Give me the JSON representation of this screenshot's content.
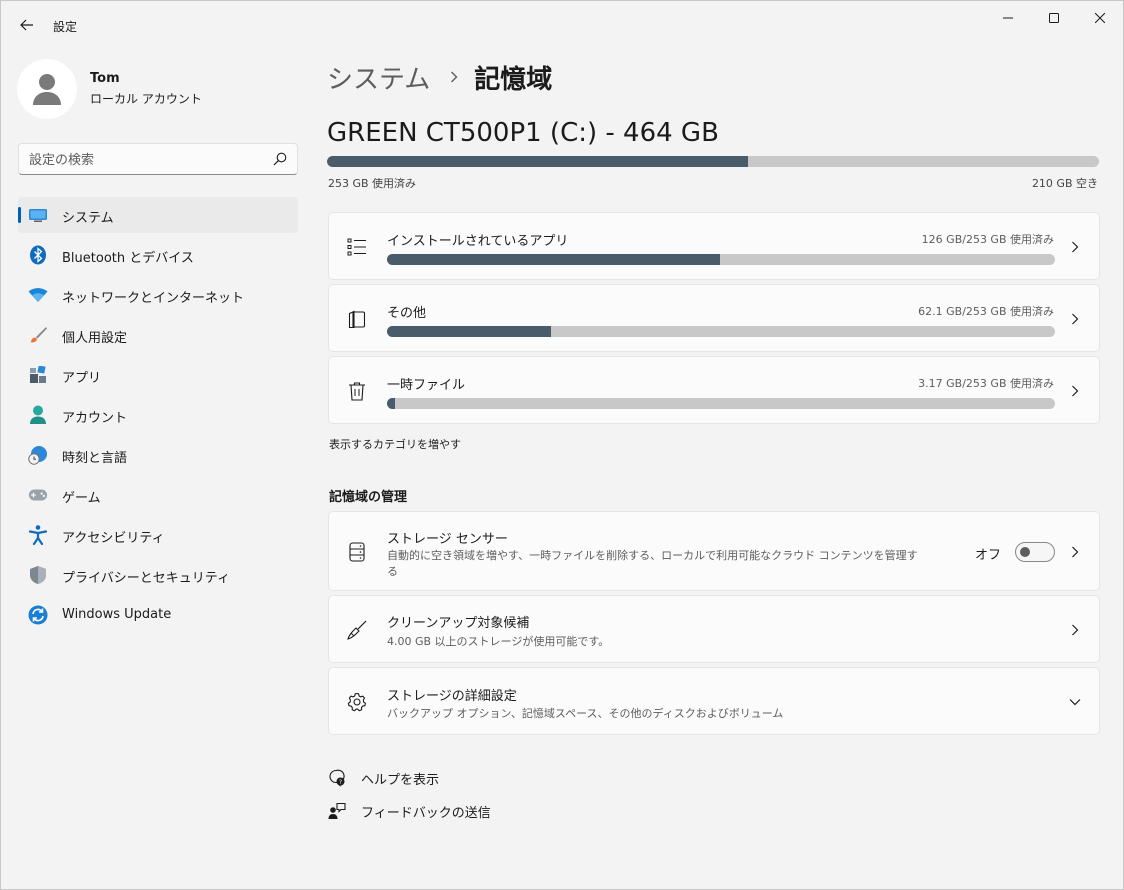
{
  "app": {
    "title": "設定"
  },
  "window_controls": {
    "minimize": "minimize-icon",
    "maximize": "maximize-icon",
    "close": "close-icon"
  },
  "profile": {
    "name": "Tom",
    "account_type": "ローカル アカウント"
  },
  "search": {
    "placeholder": "設定の検索"
  },
  "sidebar": {
    "items": [
      {
        "label": "システム",
        "icon": "system-icon",
        "active": true
      },
      {
        "label": "Bluetooth とデバイス",
        "icon": "bluetooth-icon"
      },
      {
        "label": "ネットワークとインターネット",
        "icon": "wifi-icon"
      },
      {
        "label": "個人用設定",
        "icon": "brush-icon"
      },
      {
        "label": "アプリ",
        "icon": "apps-icon"
      },
      {
        "label": "アカウント",
        "icon": "account-icon"
      },
      {
        "label": "時刻と言語",
        "icon": "time-language-icon"
      },
      {
        "label": "ゲーム",
        "icon": "gamepad-icon"
      },
      {
        "label": "アクセシビリティ",
        "icon": "accessibility-icon"
      },
      {
        "label": "プライバシーとセキュリティ",
        "icon": "shield-icon"
      },
      {
        "label": "Windows Update",
        "icon": "windows-update-icon"
      }
    ]
  },
  "breadcrumb": {
    "parent": "システム",
    "current": "記憶域"
  },
  "drive": {
    "title": "GREEN CT500P1 (C:) - 464 GB",
    "used_label": "253 GB 使用済み",
    "free_label": "210 GB 空き",
    "used_fraction": 0.545
  },
  "categories": [
    {
      "label": "インストールされているアプリ",
      "amount": "126 GB/253 GB 使用済み",
      "fraction": 0.498,
      "icon": "app-list-icon"
    },
    {
      "label": "その他",
      "amount": "62.1 GB/253 GB 使用済み",
      "fraction": 0.245,
      "icon": "other-files-icon"
    },
    {
      "label": "一時ファイル",
      "amount": "3.17 GB/253 GB 使用済み",
      "fraction": 0.0125,
      "icon": "trash-icon"
    }
  ],
  "more_categories": "表示するカテゴリを増やす",
  "management": {
    "title": "記憶域の管理",
    "storage_sense": {
      "label": "ストレージ センサー",
      "description_line1": "自動的に空き領域を増やす、一時ファイルを削除する、ローカルで利用可能なクラウド コンテンツを管理す",
      "description_line2": "る",
      "toggle_label": "オフ",
      "toggle_on": false
    },
    "cleanup": {
      "label": "クリーンアップ対象候補",
      "description": "4.00 GB 以上のストレージが使用可能です。"
    },
    "advanced": {
      "label": "ストレージの詳細設定",
      "description": "バックアップ オプション、記憶域スペース、その他のディスクおよびボリューム"
    }
  },
  "help": {
    "get_help": "ヘルプを表示",
    "feedback": "フィードバックの送信"
  }
}
